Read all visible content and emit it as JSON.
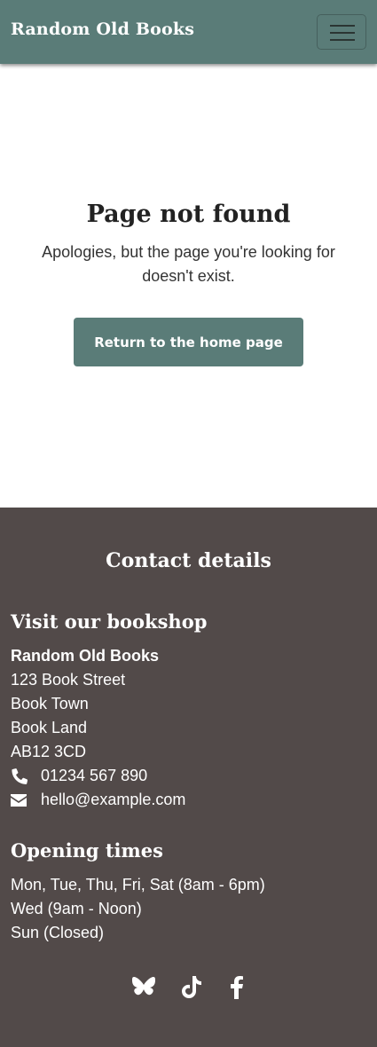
{
  "navbar": {
    "brand": "Random Old Books",
    "menu_icon": "hamburger-menu-icon"
  },
  "main": {
    "title": "Page not found",
    "message": "Apologies, but the page you're looking for doesn't exist.",
    "home_button": "Return to the home page"
  },
  "footer": {
    "title": "Contact details",
    "visit": {
      "heading": "Visit our bookshop",
      "name": "Random Old Books",
      "address": [
        "123 Book Street",
        "Book Town",
        "Book Land",
        "AB12 3CD"
      ],
      "phone": "01234 567 890",
      "email": "hello@example.com"
    },
    "opening": {
      "heading": "Opening times",
      "times": [
        "Mon, Tue, Thu, Fri, Sat (8am - 6pm)",
        "Wed (9am - Noon)",
        "Sun (Closed)"
      ]
    },
    "social": [
      "bluesky-icon",
      "tiktok-icon",
      "facebook-icon"
    ]
  },
  "colors": {
    "brand": "#5a7c78",
    "footer_bg": "#524a49",
    "text": "#333333"
  }
}
